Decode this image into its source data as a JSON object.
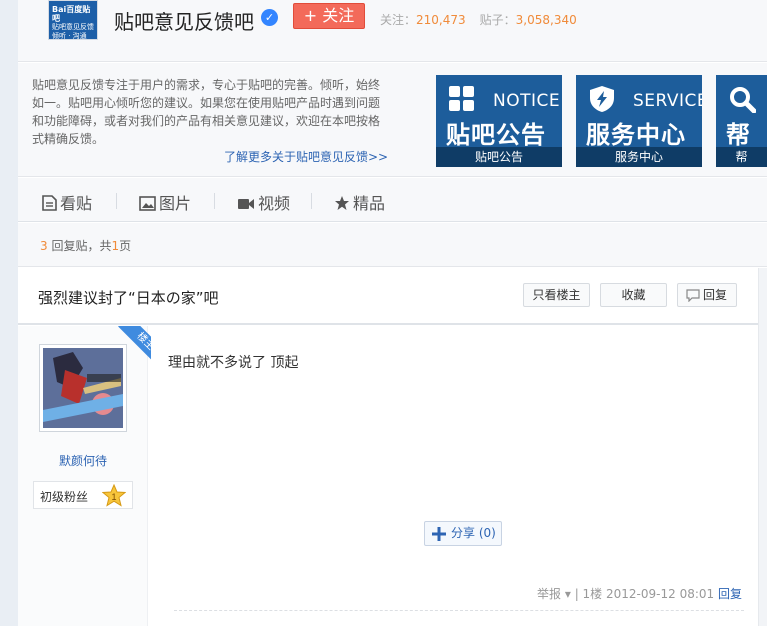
{
  "header": {
    "logo_line1": "Bai百度贴吧",
    "logo_line2": "贴吧意见反馈",
    "logo_line3": "倾听 · 沟通",
    "forum_name": "贴吧意见反馈吧",
    "follow_label": "+ 关注",
    "follow_count_label": "关注：",
    "follow_count": "210,473",
    "post_count_label": "贴子：",
    "post_count": "3,058,340"
  },
  "intro": {
    "text": "贴吧意见反馈专注于用户的需求，专心于贴吧的完善。倾听，始终如一。贴吧用心倾听您的建议。如果您在使用贴吧产品时遇到问题和功能障碍，或者对我们的产品有相关意见建议，欢迎在本吧按格式精确反馈。",
    "more_link": "了解更多关于贴吧意见反馈>>",
    "cards": [
      {
        "en": "NOTICE",
        "zh": "贴吧公告",
        "caption": "贴吧公告",
        "icon": "grid-icon"
      },
      {
        "en": "SERVICE",
        "zh": "服务中心",
        "caption": "服务中心",
        "icon": "shield-bolt-icon"
      },
      {
        "en": "",
        "zh": "帮助",
        "caption": "帮",
        "icon": "magnifier-icon"
      }
    ]
  },
  "tabs": [
    {
      "label": "看贴",
      "icon": "document-icon"
    },
    {
      "label": "图片",
      "icon": "picture-icon"
    },
    {
      "label": "视频",
      "icon": "video-icon"
    },
    {
      "label": "精品",
      "icon": "star-icon"
    }
  ],
  "reply_info": {
    "count": "3",
    "mid": " 回复贴，共",
    "pages": "1",
    "suffix": "页"
  },
  "thread": {
    "title": "强烈建议封了“日本の家”吧",
    "only_op_label": "只看楼主",
    "favorite_label": "收藏",
    "reply_label": "回复"
  },
  "post": {
    "op_badge": "楼主",
    "username": "默颜何待",
    "level_label": "初级粉丝",
    "level_number": "1",
    "content": "理由就不多说了 顶起",
    "share_label": "分享",
    "share_count": "(0)",
    "report_label": "举报",
    "floor": "1楼",
    "timestamp": "2012-09-12 08:01",
    "reply_link": "回复"
  },
  "colors": {
    "accent": "#2d64b3",
    "follow": "#f36a5a",
    "card_blue": "#1d5d9b",
    "stat_orange": "#f08b3a"
  }
}
